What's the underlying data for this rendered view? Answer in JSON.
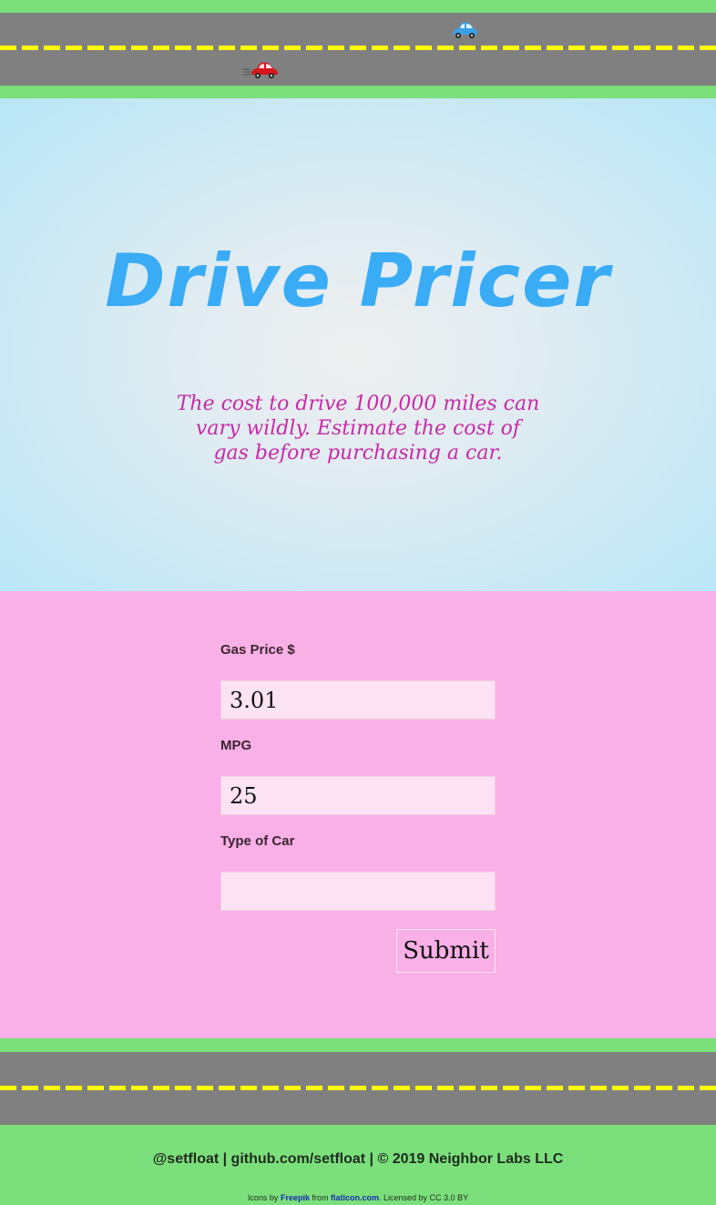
{
  "road_top": {
    "cars": [
      {
        "name": "blue-car-icon",
        "color": "#3aa0e6"
      },
      {
        "name": "red-car-icon",
        "color": "#d8161d"
      }
    ]
  },
  "hero": {
    "title": "Drive Pricer",
    "subtitle": "The cost to drive 100,000 miles can vary wildly. Estimate the cost of gas before purchasing a car."
  },
  "form": {
    "gas_price": {
      "label": "Gas Price $",
      "value": "3.01"
    },
    "mpg": {
      "label": "MPG",
      "value": "25"
    },
    "car_type": {
      "label": "Type of Car",
      "value": ""
    },
    "submit_label": "Submit"
  },
  "footer": {
    "credit": "@setfloat | github.com/setfloat | © 2019 Neighbor Labs LLC",
    "icons_prefix": "Icons by",
    "freepik": "Freepik",
    "from_text": "from",
    "flaticon": "flaticon.com",
    "license": ". Licensed by CC 3.0 BY"
  },
  "colors": {
    "grass": "#7be07b",
    "road": "#808080",
    "lane": "#ffff00",
    "title": "#3aacf6",
    "subtitle": "#c62aa8",
    "form_bg": "#f8b0e6"
  }
}
